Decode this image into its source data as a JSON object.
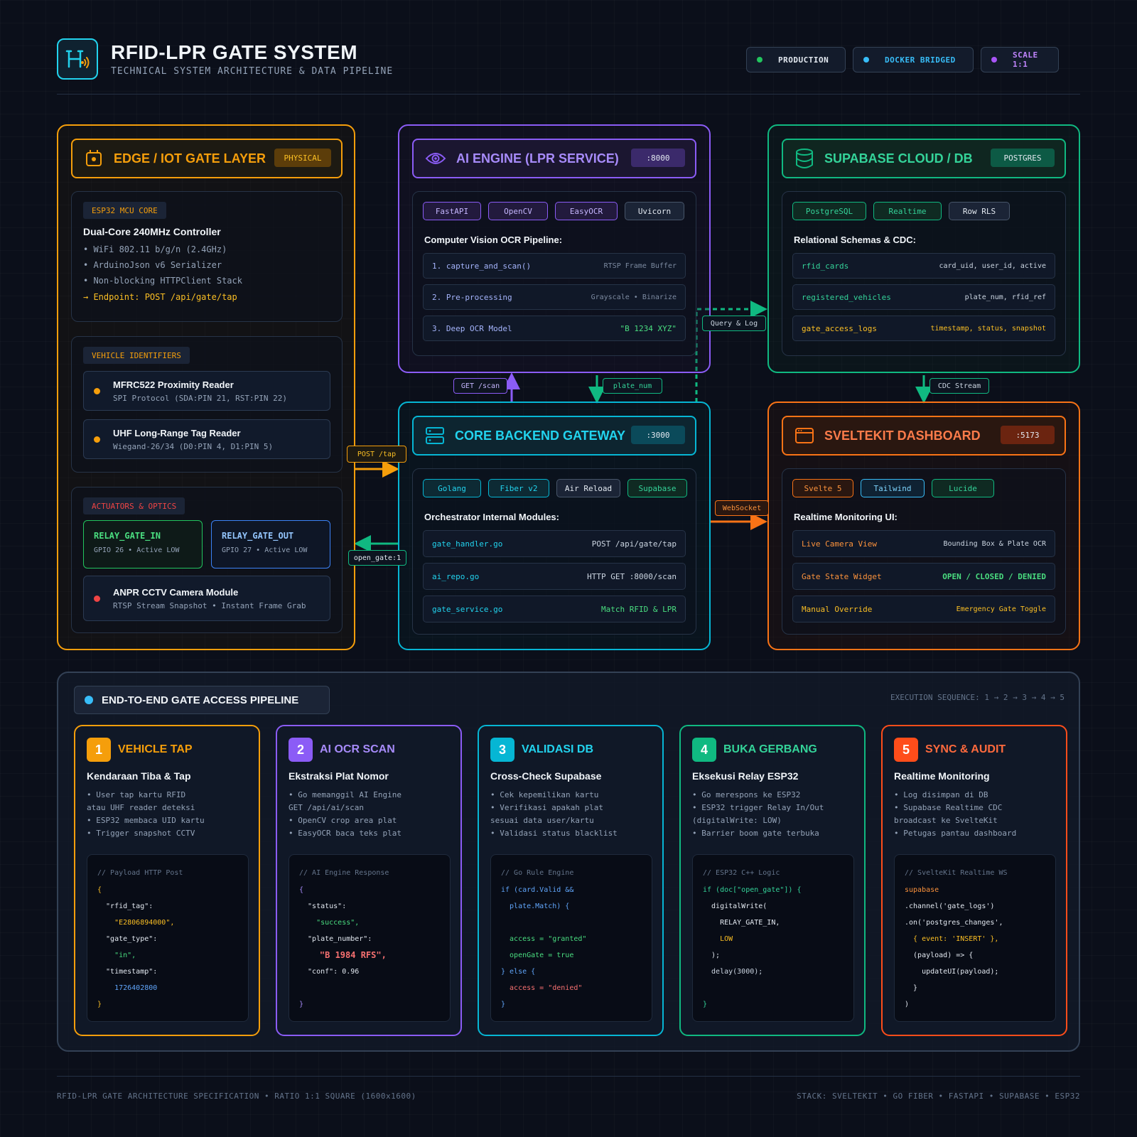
{
  "header": {
    "title": "RFID-LPR GATE SYSTEM",
    "subtitle": "TECHNICAL SYSTEM ARCHITECTURE & DATA PIPELINE",
    "pills": [
      {
        "label": "PRODUCTION",
        "color": "#22c55e"
      },
      {
        "label": "DOCKER BRIDGED",
        "color": "#38bdf8"
      },
      {
        "label": "SCALE 1:1",
        "color": "#a855f7"
      }
    ]
  },
  "edge": {
    "title": "EDGE / IOT GATE LAYER",
    "badge": "PHYSICAL",
    "mcu": {
      "tag": "ESP32 MCU CORE",
      "heading": "Dual-Core 240MHz Controller",
      "bullets": [
        "• WiFi 802.11 b/g/n (2.4GHz)",
        "• ArduinoJson v6 Serializer",
        "• Non-blocking HTTPClient Stack"
      ],
      "endpoint": "→ Endpoint: POST /api/gate/tap"
    },
    "ident": {
      "tag": "VEHICLE IDENTIFIERS",
      "readers": [
        {
          "title": "MFRC522 Proximity Reader",
          "sub": "SPI Protocol (SDA:PIN 21, RST:PIN 22)"
        },
        {
          "title": "UHF Long-Range Tag Reader",
          "sub": "Wiegand-26/34 (D0:PIN 4, D1:PIN 5)"
        }
      ]
    },
    "act": {
      "tag": "ACTUATORS & OPTICS",
      "relay_in": {
        "title": "RELAY_GATE_IN",
        "sub": "GPIO 26 • Active LOW"
      },
      "relay_out": {
        "title": "RELAY_GATE_OUT",
        "sub": "GPIO 27 • Active LOW"
      },
      "camera": {
        "title": "ANPR CCTV Camera Module",
        "sub": "RTSP Stream Snapshot • Instant Frame Grab"
      }
    }
  },
  "ai": {
    "title": "AI ENGINE (LPR SERVICE)",
    "port": ":8000",
    "chips": [
      "FastAPI",
      "OpenCV",
      "EasyOCR",
      "Uvicorn"
    ],
    "heading": "Computer Vision OCR Pipeline:",
    "rows": [
      {
        "l": "1. capture_and_scan()",
        "r": "RTSP Frame Buffer"
      },
      {
        "l": "2. Pre-processing",
        "r": "Grayscale • Binarize"
      },
      {
        "l": "3. Deep OCR Model",
        "r": "\"B 1234 XYZ\""
      }
    ]
  },
  "db": {
    "title": "SUPABASE CLOUD / DB",
    "badge": "POSTGRES",
    "chips": [
      "PostgreSQL",
      "Realtime",
      "Row RLS"
    ],
    "heading": "Relational Schemas & CDC:",
    "rows": [
      {
        "l": "rfid_cards",
        "r": "card_uid, user_id, active"
      },
      {
        "l": "registered_vehicles",
        "r": "plate_num, rfid_ref"
      },
      {
        "l": "gate_access_logs",
        "r": "timestamp, status, snapshot"
      }
    ]
  },
  "backend": {
    "title": "CORE BACKEND GATEWAY",
    "port": ":3000",
    "chips": [
      "Golang",
      "Fiber v2",
      "Air Reload",
      "Supabase"
    ],
    "heading": "Orchestrator Internal Modules:",
    "rows": [
      {
        "l": "gate_handler.go",
        "r": "POST /api/gate/tap"
      },
      {
        "l": "ai_repo.go",
        "r": "HTTP GET :8000/scan"
      },
      {
        "l": "gate_service.go",
        "r": "Match RFID & LPR"
      }
    ]
  },
  "dash": {
    "title": "SVELTEKIT DASHBOARD",
    "port": ":5173",
    "chips": [
      "Svelte 5",
      "Tailwind",
      "Lucide"
    ],
    "heading": "Realtime Monitoring UI:",
    "rows": [
      {
        "l": "Live Camera View",
        "r": "Bounding Box & Plate OCR"
      },
      {
        "l": "Gate State Widget",
        "r": "OPEN / CLOSED / DENIED"
      },
      {
        "l": "Manual Override",
        "r": "Emergency Gate Toggle"
      }
    ]
  },
  "connectors": {
    "get_scan": "GET /scan",
    "plate_num": "plate_num",
    "query_log": "Query & Log",
    "cdc_stream": "CDC Stream",
    "post_tap": "POST /tap",
    "open_gate": "open_gate:1",
    "websocket": "WebSocket"
  },
  "pipeline": {
    "title": "END-TO-END GATE ACCESS PIPELINE",
    "sequence": "EXECUTION SEQUENCE: 1 → 2 → 3 → 4 → 5",
    "steps": [
      {
        "num": "1",
        "title": "VEHICLE TAP",
        "sub": "Kendaraan Tiba & Tap",
        "desc": "• User tap kartu RFID\natau UHF reader deteksi\n• ESP32 membaca UID kartu\n• Trigger snapshot CCTV",
        "code": [
          "// Payload HTTP Post",
          "{",
          "  \"rfid_tag\":",
          "    \"E2806894000\",",
          "  \"gate_type\":",
          "    \"in\",",
          "  \"timestamp\":",
          "    1726402800",
          "}"
        ]
      },
      {
        "num": "2",
        "title": "AI OCR SCAN",
        "sub": "Ekstraksi Plat Nomor",
        "desc": "• Go memanggil AI Engine\nGET /api/ai/scan\n• OpenCV crop area plat\n• EasyOCR baca teks plat",
        "code": [
          "// AI Engine Response",
          "{",
          "  \"status\":",
          "    \"success\",",
          "  \"plate_number\":",
          "    \"B 1984 RFS\",",
          "  \"conf\": 0.96",
          "",
          "}"
        ]
      },
      {
        "num": "3",
        "title": "VALIDASI DB",
        "sub": "Cross-Check Supabase",
        "desc": "• Cek kepemilikan kartu\n• Verifikasi apakah plat\nsesuai data user/kartu\n• Validasi status blacklist",
        "code": [
          "// Go Rule Engine",
          "if (card.Valid &&",
          "  plate.Match) {",
          "",
          "  access = \"granted\"",
          "  openGate = true",
          "} else {",
          "  access = \"denied\"",
          "}"
        ]
      },
      {
        "num": "4",
        "title": "BUKA GERBANG",
        "sub": "Eksekusi Relay ESP32",
        "desc": "• Go merespons ke ESP32\n• ESP32 trigger Relay In/Out\n(digitalWrite: LOW)\n• Barrier boom gate terbuka",
        "code": [
          "// ESP32 C++ Logic",
          "if (doc[\"open_gate\"]) {",
          "  digitalWrite(",
          "    RELAY_GATE_IN,",
          "    LOW",
          "  );",
          "  delay(3000);",
          "",
          "}"
        ]
      },
      {
        "num": "5",
        "title": "SYNC & AUDIT",
        "sub": "Realtime Monitoring",
        "desc": "• Log disimpan di DB\n• Supabase Realtime CDC\nbroadcast ke SvelteKit\n• Petugas pantau dashboard",
        "code": [
          "// SvelteKit Realtime WS",
          "supabase",
          ".channel('gate_logs')",
          ".on('postgres_changes',",
          "  { event: 'INSERT' },",
          "  (payload) => {",
          "    updateUI(payload);",
          "  }",
          ")"
        ]
      }
    ]
  },
  "footer": {
    "left": "RFID-LPR GATE ARCHITECTURE SPECIFICATION • RATIO 1:1 SQUARE (1600x1600)",
    "right": "STACK: SVELTEKIT • GO FIBER • FASTAPI • SUPABASE • ESP32"
  },
  "colors": {
    "edge": "#f59e0b",
    "ai": "#8b5cf6",
    "db": "#10b981",
    "backend": "#06b6d4",
    "dash": "#f97316",
    "step5": "#ff4d1a"
  }
}
